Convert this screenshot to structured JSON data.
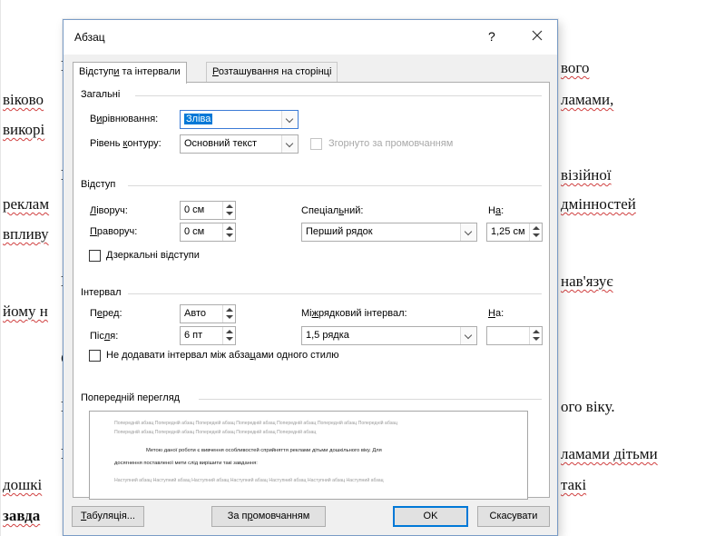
{
  "document": {
    "lines": [
      {
        "text": "І",
        "bold": true
      },
      {
        "text": "віково",
        "squiggle": true
      },
      {
        "text": "викорі",
        "squiggle": true
      },
      {
        "text": "І",
        "bold": true
      },
      {
        "text": "реклам",
        "squiggle": true
      },
      {
        "text": "впливу",
        "squiggle": true
      },
      {
        "text": "І",
        "bold": true
      },
      {
        "text": "йому н",
        "squiggle": true
      },
      {
        "text": "С",
        "bold": true
      },
      {
        "text": "І",
        "bold": true
      },
      {
        "text": "І",
        "bold": true
      },
      {
        "text": "дошкі",
        "squiggle": true
      },
      {
        "text": "завда",
        "bold": true,
        "squiggle": true
      }
    ],
    "right_lines": [
      {
        "text": "вого",
        "squiggle": true
      },
      {
        "text": "ламами,",
        "squiggle": true
      },
      {
        "text": "візійної",
        "squiggle": true
      },
      {
        "text": "дмінностей",
        "squiggle": true
      },
      {
        "text": "нав'язує",
        "squiggle": true
      },
      {
        "text": "ого віку."
      },
      {
        "text": "ламами дітьми",
        "squiggle": true
      },
      {
        "text": "такі",
        "squiggle": true
      }
    ]
  },
  "dialog": {
    "title": "Абзац",
    "help": "?",
    "tabs": [
      {
        "pre": "Відступ",
        "u": "и",
        "post": " та інтервали",
        "active": true
      },
      {
        "pre": "",
        "u": "Р",
        "post": "озташування на сторінці",
        "active": false
      }
    ],
    "general": {
      "heading": "Загальні",
      "alignment_label": {
        "pre": "В",
        "u": "и",
        "post": "рівнювання:"
      },
      "alignment_value": "Зліва",
      "outline_label": {
        "pre": "Рівень ",
        "u": "к",
        "post": "онтуру:"
      },
      "outline_value": "Основний текст",
      "collapsed_label": "Згорнуто за промовчанням"
    },
    "indent": {
      "heading": "Відступ",
      "left_label": {
        "pre": "",
        "u": "Л",
        "post": "іворуч:"
      },
      "left_value": "0 см",
      "right_label": {
        "pre": "",
        "u": "П",
        "post": "раворуч:"
      },
      "right_value": "0 см",
      "special_label": {
        "pre": "Спеціал",
        "u": "ь",
        "post": "ний:"
      },
      "special_value": "Перший рядок",
      "by_label": {
        "pre": "Н",
        "u": "а",
        "post": ":"
      },
      "by_value": "1,25 см",
      "mirror_label": {
        "pre": "",
        "u": "Д",
        "post": "зеркальні відступи"
      }
    },
    "spacing": {
      "heading": "Інтервал",
      "before_label": {
        "pre": "П",
        "u": "е",
        "post": "ред:"
      },
      "before_value": "Авто",
      "after_label": {
        "pre": "Піс",
        "u": "л",
        "post": "я:"
      },
      "after_value": "6 пт",
      "line_label": {
        "pre": "Мі",
        "u": "ж",
        "post": "рядковий інтервал:"
      },
      "line_value": "1,5 рядка",
      "at_label": {
        "pre": "",
        "u": "Н",
        "post": "а:"
      },
      "at_value": "",
      "dont_add_label": {
        "pre": "Не додавати інтервал між абза",
        "u": "ц",
        "post": "ами одного стилю"
      }
    },
    "preview": {
      "heading": "Попередній перегляд",
      "prev_line": "Попередній абзац Попередній абзац Попередній абзац Попередній абзац Попередній абзац Попередній абзац Попередній абзац",
      "prev_line2": "Попередній абзац Попередній абзац Попередній абзац Попередній абзац Попередній абзац",
      "main_line1": "Метою даної роботи є вивчення особливостей сприйняття реклами дітьми дошкільного віку. Для",
      "main_line2": "досягнення поставленої мети слід вирішити такі завдання:",
      "next_line": "Наступний абзац Наступний абзац Наступний абзац Наступний абзац Наступний абзац Наступний абзац Наступний абзац"
    },
    "buttons": {
      "tabs": {
        "pre": "",
        "u": "Т",
        "post": "абуляція..."
      },
      "default": {
        "pre": "За п",
        "u": "р",
        "post": "омовчанням"
      },
      "ok": "OK",
      "cancel": "Скасувати"
    }
  }
}
